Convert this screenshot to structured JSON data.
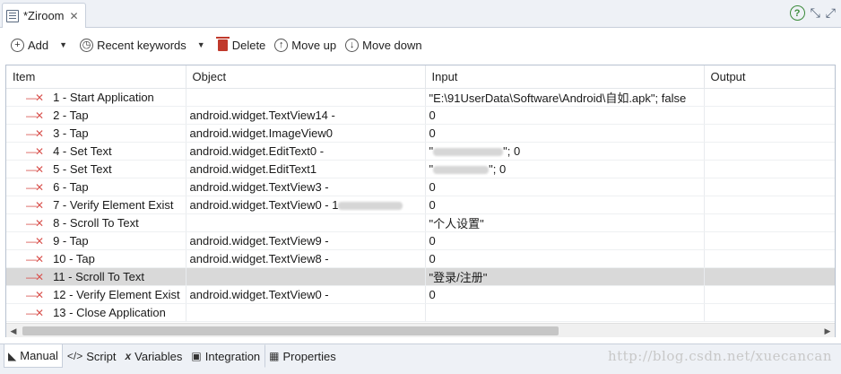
{
  "tab": {
    "title": "*Ziroom",
    "close_glyph": "✕"
  },
  "tab_tools": [
    {
      "name": "help-icon",
      "glyph": "?"
    },
    {
      "name": "restore-icon",
      "glyph": "⤡"
    },
    {
      "name": "maximize-icon",
      "glyph": "⤢"
    }
  ],
  "toolbar": {
    "add_label": "Add",
    "recent_label": "Recent keywords",
    "delete_label": "Delete",
    "move_up_label": "Move up",
    "move_down_label": "Move down"
  },
  "table": {
    "columns": [
      "Item",
      "Object",
      "Input",
      "Output"
    ],
    "rows": [
      {
        "item": "1 - Start Application",
        "object": "",
        "input": "\"E:\\91UserData\\Software\\Android\\自如.apk\"; false",
        "output": ""
      },
      {
        "item": "2 - Tap",
        "object": "android.widget.TextView14 -",
        "input": "0",
        "output": ""
      },
      {
        "item": "3 - Tap",
        "object": "android.widget.ImageView0",
        "input": "0",
        "output": ""
      },
      {
        "item": "4 - Set Text",
        "object": "android.widget.EditText0 -",
        "input": "\"",
        "input_suffix": "\"; 0",
        "output": ""
      },
      {
        "item": "5 - Set Text",
        "object": "android.widget.EditText1",
        "input": "\"",
        "input_suffix": "\"; 0",
        "output": ""
      },
      {
        "item": "6 - Tap",
        "object": "android.widget.TextView3 -",
        "input": "0",
        "output": ""
      },
      {
        "item": "7 - Verify Element Exist",
        "object": "android.widget.TextView0 - 1",
        "input": "0",
        "output": ""
      },
      {
        "item": "8 - Scroll To Text",
        "object": "",
        "input": "\"个人设置\"",
        "output": ""
      },
      {
        "item": "9 - Tap",
        "object": "android.widget.TextView9 -",
        "input": "0",
        "output": ""
      },
      {
        "item": "10 - Tap",
        "object": "android.widget.TextView8 -",
        "input": "0",
        "output": ""
      },
      {
        "item": "11 - Scroll To Text",
        "object": "",
        "input": "\"登录/注册\"",
        "output": ""
      },
      {
        "item": "12 - Verify Element Exist",
        "object": "android.widget.TextView0 -",
        "input": "0",
        "output": ""
      },
      {
        "item": "13 - Close Application",
        "object": "",
        "input": "",
        "output": ""
      }
    ]
  },
  "bottom_tabs": [
    {
      "label": "Manual",
      "icon": "manual-icon"
    },
    {
      "label": "Script",
      "icon": "script-icon"
    },
    {
      "label": "Variables",
      "icon": "variables-icon"
    },
    {
      "label": "Integration",
      "icon": "integration-icon"
    },
    {
      "label": "Properties",
      "icon": "properties-icon"
    }
  ],
  "watermark": "http://blog.csdn.net/xuecancan"
}
